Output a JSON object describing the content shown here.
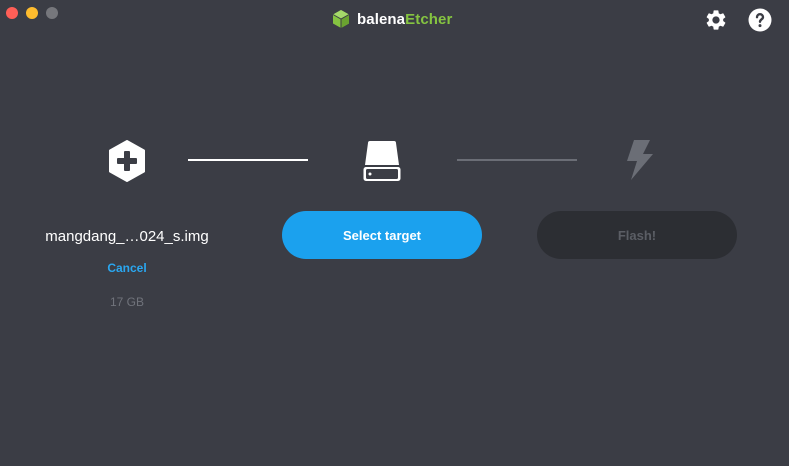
{
  "titlebar": {
    "logo_text_part1": "balena",
    "logo_text_part2": "Etcher"
  },
  "colors": {
    "background": "#3b3d45",
    "accent_blue": "#1ba1ee",
    "link_blue": "#2aa7f0",
    "brand_green": "#85c441",
    "disabled_button": "#2c2e33"
  },
  "steps": {
    "image": {
      "filename": "mangdang_…024_s.img",
      "cancel_label": "Cancel",
      "size": "17 GB"
    },
    "target": {
      "button_label": "Select target"
    },
    "flash": {
      "button_label": "Flash!"
    }
  },
  "icons": {
    "image_step": "plus-hexagon-icon",
    "target_step": "drive-icon",
    "flash_step": "lightning-icon",
    "settings": "gear-icon",
    "help": "help-icon"
  }
}
